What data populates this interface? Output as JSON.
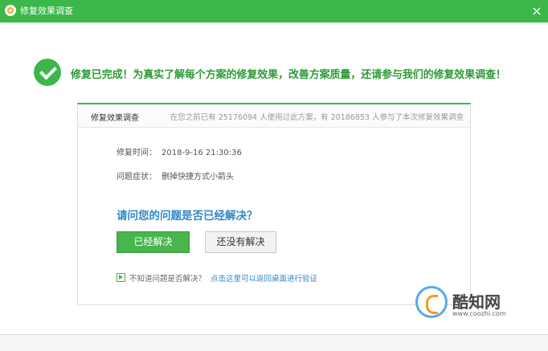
{
  "window": {
    "title": "修复效果调查",
    "close_glyph": "×",
    "accent_color": "#3cb84a"
  },
  "main": {
    "heading": "修复已完成！为真实了解每个方案的修复效果，改善方案质量，还请参与我们的修复效果调查！"
  },
  "card": {
    "title": "修复效果调查",
    "stats": "在您之前已有 25176094 人使用过此方案，有 20186853 人参与了本次修复效果调查",
    "repair_time_label": "修复时间：",
    "repair_time_value": "2018-9-16 21:30:36",
    "symptom_label": "问题症状：",
    "symptom_value": "删掉快捷方式小箭头",
    "question": "请问您的问题是否已经解决？",
    "resolved_button": "已经解决",
    "unresolved_button": "还没有解决",
    "help_text": "不知道问题是否解决？",
    "help_link": "点击这里可以返回桌面进行验证"
  },
  "watermark": {
    "name": "酷知网",
    "url": "www.coozhi.com"
  },
  "icons": {
    "app": "app-logo-icon",
    "close": "close-icon",
    "success": "check-circle-icon",
    "help": "arrow-box-icon"
  }
}
